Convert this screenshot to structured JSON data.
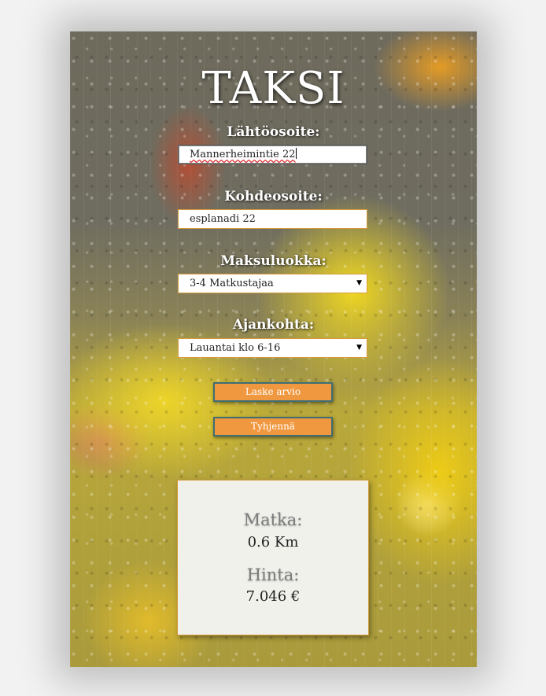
{
  "app": {
    "title": "TAKSI"
  },
  "form": {
    "origin": {
      "label": "Lähtöosoite:",
      "value": "Mannerheimintie 22"
    },
    "destination": {
      "label": "Kohdeosoite:",
      "value": "esplanadi 22"
    },
    "fare_class": {
      "label": "Maksuluokka:",
      "selected": "3-4 Matkustajaa"
    },
    "time": {
      "label": "Ajankohta:",
      "selected": "Lauantai klo 6-16"
    }
  },
  "buttons": {
    "calculate": "Laske arvio",
    "clear": "Tyhjennä"
  },
  "result": {
    "distance_label": "Matka:",
    "distance_value": "0.6 Km",
    "price_label": "Hinta:",
    "price_value": "7.046 €"
  },
  "colors": {
    "button": "#f0983f",
    "button_border": "#3f6e73",
    "field_border": "#d69a3a"
  },
  "icons": {
    "select_arrow": "triangle-down-icon"
  }
}
